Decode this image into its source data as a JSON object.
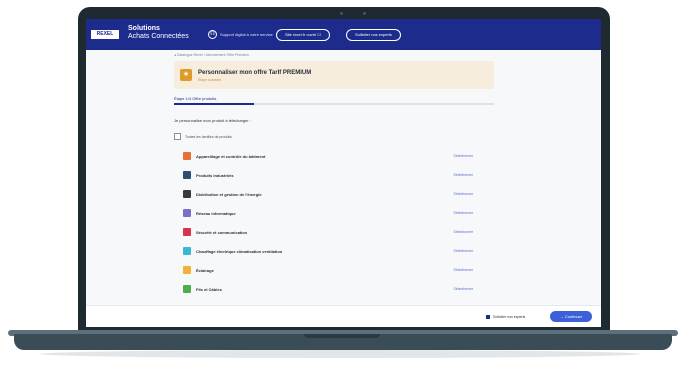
{
  "header": {
    "logo": "REXEL",
    "title_line1": "Solutions",
    "title_line2": "Achats Connectées",
    "agent_label": "Support digital à votre service",
    "button_site": "Site rexel.fr ouvrir ☐",
    "button_help": "Solliciter nos experts"
  },
  "breadcrumb": "◂ Catalogue Rexel › Abonnement Offre Premium",
  "offer": {
    "icon": "★",
    "title": "Personnaliser mon offre TarIf PREMIUM",
    "subtitle": "Étape suivante"
  },
  "step": {
    "label": "Étape 1/4  Offre produits",
    "progress_percent": 25
  },
  "intro_text": "Je personnalise mon produit à télécharger :",
  "select_all_label": "Toutes les familles de produits",
  "categories": [
    {
      "label": "Appareillage et contrôle du bâtiment",
      "action": "Sélectionner",
      "color": "#e8703a"
    },
    {
      "label": "Produits industriels",
      "action": "Sélectionner",
      "color": "#2f4f6f"
    },
    {
      "label": "Distribution et gestion de l'énergie",
      "action": "Sélectionner",
      "color": "#3a3a3a"
    },
    {
      "label": "Réseau informatique",
      "action": "Sélectionner",
      "color": "#7a6fc9"
    },
    {
      "label": "Sécurité et communication",
      "action": "Sélectionner",
      "color": "#d6334f"
    },
    {
      "label": "Chauffage électrique climatisation ventilation",
      "action": "Sélectionner",
      "color": "#3cb7d6"
    },
    {
      "label": "Éclairage",
      "action": "Sélectionner",
      "color": "#f2b23a"
    },
    {
      "label": "Fils et Câbles",
      "action": "Sélectionner",
      "color": "#4cae4f"
    }
  ],
  "footer": {
    "help_label": "Solliciter nos experts",
    "continue_label": "→ Continuer"
  }
}
